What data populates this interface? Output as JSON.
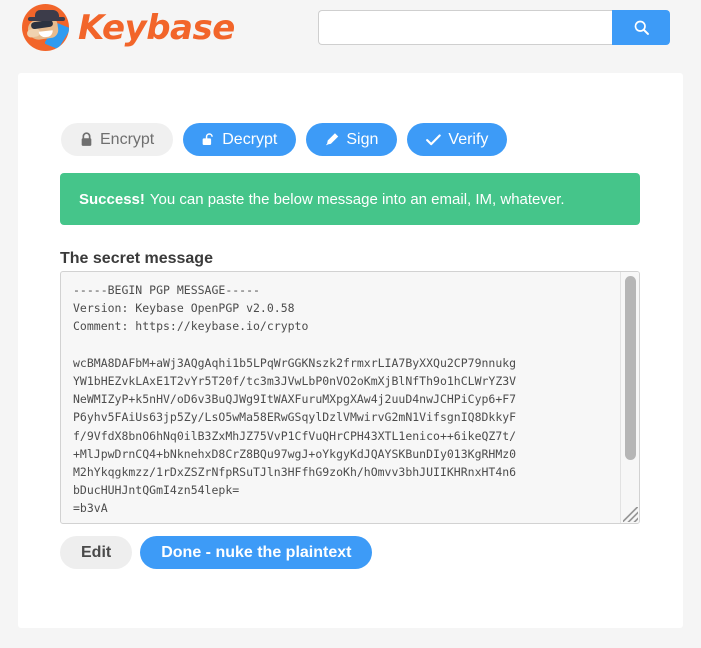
{
  "header": {
    "brand_name": "Keybase",
    "logo_icon": "keybase-mascot-icon",
    "search": {
      "value": "",
      "placeholder": "",
      "button_icon": "search-icon"
    }
  },
  "main": {
    "tabs": [
      {
        "label": "Encrypt",
        "icon": "lock-closed-icon",
        "active": false
      },
      {
        "label": "Decrypt",
        "icon": "lock-open-icon",
        "active": true
      },
      {
        "label": "Sign",
        "icon": "pencil-icon",
        "active": true
      },
      {
        "label": "Verify",
        "icon": "check-icon",
        "active": true
      }
    ],
    "alert": {
      "strong": "Success!",
      "text": "You can paste the below message into an email, IM, whatever."
    },
    "message_label": "The secret message",
    "message_value": "-----BEGIN PGP MESSAGE-----\nVersion: Keybase OpenPGP v2.0.58\nComment: https://keybase.io/crypto\n\nwcBMA8DAFbM+aWj3AQgAqhi1b5LPqWrGGKNszk2frmxrLIA7ByXXQu2CP79nnukg\nYW1bHEZvkLAxE1T2vYr5T20f/tc3m3JVwLbP0nVO2oKmXjBlNfTh9o1hCLWrYZ3V\nNeWMIZyP+k5nHV/oD6v3BuQJWg9ItWAXFuruMXpgXAw4j2uuD4nwJCHPiCyp6+F7\nP6yhv5FAiUs63jp5Zy/LsO5wMa58ERwGSqylDzlVMwirvG2mN1VifsgnIQ8DkkyF\nf/9VfdX8bnO6hNq0ilB3ZxMhJZ75VvP1CfVuQHrCPH43XTL1enico++6ikeQZ7t/\n+MlJpwDrnCQ4+bNknehxD8CrZ8BQu97wgJ+oYkgyKdJQAYSKBunDIy013KgRHMz0\nM2hYkqgkmzz/1rDxZSZrNfpRSuTJln3HFfhG9zoKh/hOmvv3bhJUIIKHRnxHT4n6\nbDucHUHJntQGmI4zn54lepk=\n=b3vA",
    "scrollbar": {
      "icon": "vertical-scrollbar"
    },
    "resize_handle_icon": "resize-grip-icon",
    "buttons": [
      {
        "label": "Edit",
        "style": "grey"
      },
      {
        "label": "Done - nuke the plaintext",
        "style": "blue"
      }
    ]
  },
  "colors": {
    "brand_orange": "#f2652a",
    "accent_blue": "#3d9bf7",
    "success_green": "#45c58a",
    "page_bg": "#f5f5f5",
    "card_bg": "#ffffff"
  }
}
